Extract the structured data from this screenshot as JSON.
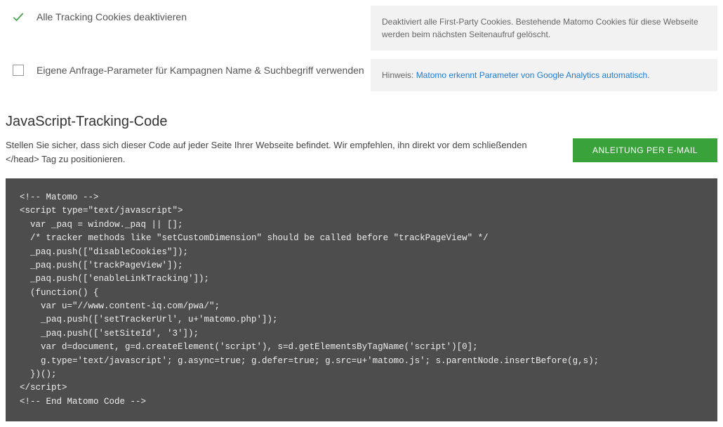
{
  "options": [
    {
      "label": "Alle Tracking Cookies deaktivieren",
      "checked": true,
      "info": "Deaktiviert alle First-Party Cookies. Bestehende Matomo Cookies für diese Webseite werden beim nächsten Seitenaufruf gelöscht."
    },
    {
      "label": "Eigene Anfrage-Parameter für Kampagnen Name & Suchbegriff verwenden",
      "checked": false,
      "hint_prefix": "Hinweis: ",
      "hint_link": "Matomo erkennt Parameter von Google Analytics automatisch."
    }
  ],
  "tracking": {
    "title": "JavaScript-Tracking-Code",
    "description": "Stellen Sie sicher, dass sich dieser Code auf jeder Seite Ihrer Webseite befindet. Wir empfehlen, ihn direkt vor dem schließenden </head> Tag zu positionieren.",
    "button": "ANLEITUNG PER E-MAIL",
    "code": "<!-- Matomo -->\n<script type=\"text/javascript\">\n  var _paq = window._paq || [];\n  /* tracker methods like \"setCustomDimension\" should be called before \"trackPageView\" */\n  _paq.push([\"disableCookies\"]);\n  _paq.push(['trackPageView']);\n  _paq.push(['enableLinkTracking']);\n  (function() {\n    var u=\"//www.content-iq.com/pwa/\";\n    _paq.push(['setTrackerUrl', u+'matomo.php']);\n    _paq.push(['setSiteId', '3']);\n    var d=document, g=d.createElement('script'), s=d.getElementsByTagName('script')[0];\n    g.type='text/javascript'; g.async=true; g.defer=true; g.src=u+'matomo.js'; s.parentNode.insertBefore(g,s);\n  })();\n</script>\n<!-- End Matomo Code -->"
  }
}
